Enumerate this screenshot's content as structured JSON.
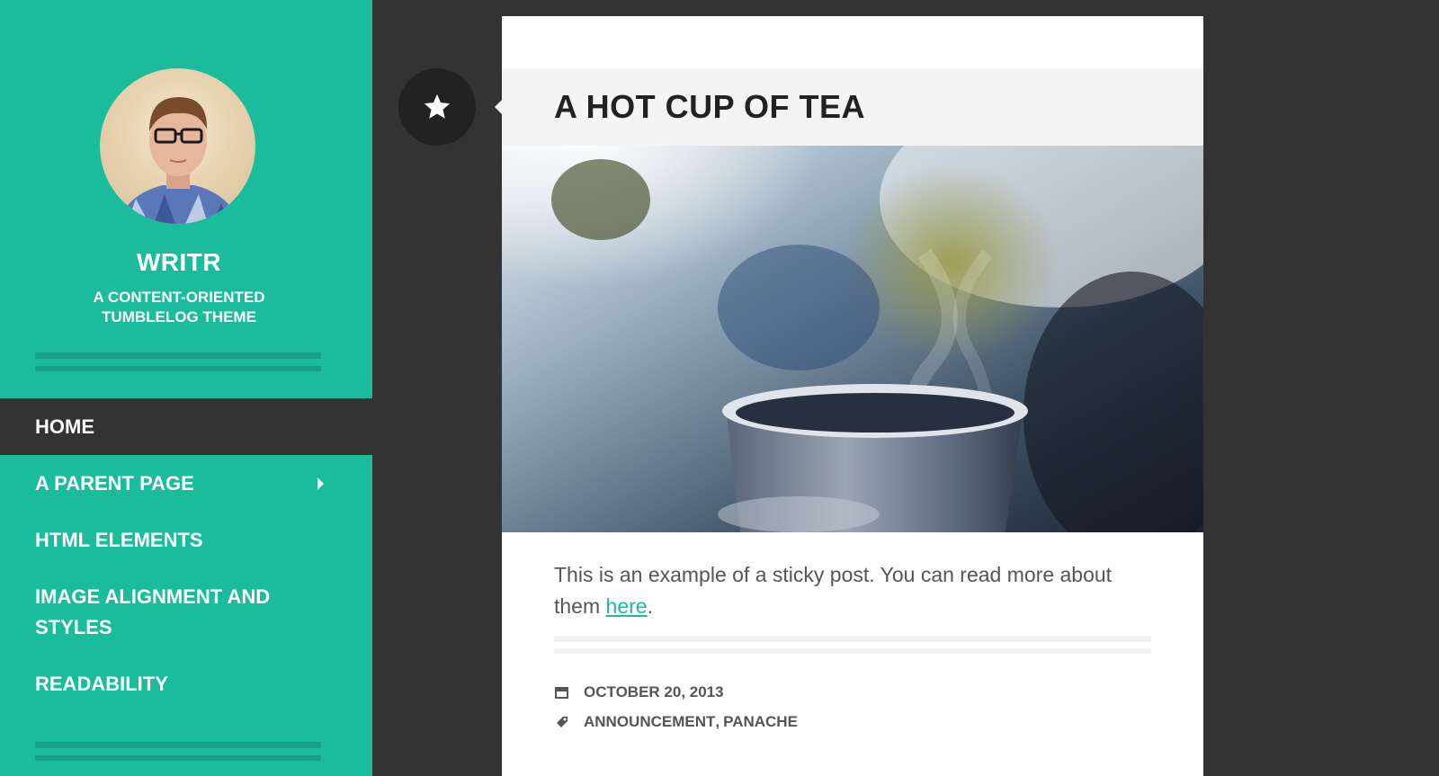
{
  "site": {
    "title": "WRITR",
    "description": "A CONTENT-ORIENTED TUMBLELOG THEME"
  },
  "nav": {
    "items": [
      {
        "label": "HOME",
        "active": true
      },
      {
        "label": "A PARENT PAGE",
        "has_children": true
      },
      {
        "label": "HTML ELEMENTS"
      },
      {
        "label": "IMAGE ALIGNMENT AND STYLES"
      },
      {
        "label": "READABILITY"
      }
    ]
  },
  "post": {
    "badge_icon": "star-icon",
    "title": "A HOT CUP OF TEA",
    "image_subject": "steaming cup of tea",
    "excerpt": "This is an example of a sticky post. You can read more about them ",
    "link_text": "here",
    "after_link": ".",
    "date": "OCTOBER 20, 2013",
    "categories": [
      "ANNOUNCEMENT",
      "PANACHE"
    ],
    "category_sep": ","
  },
  "colors": {
    "accent": "#1abc9c",
    "accent_dark": "#16a085",
    "background": "#333333",
    "text": "#555555"
  }
}
